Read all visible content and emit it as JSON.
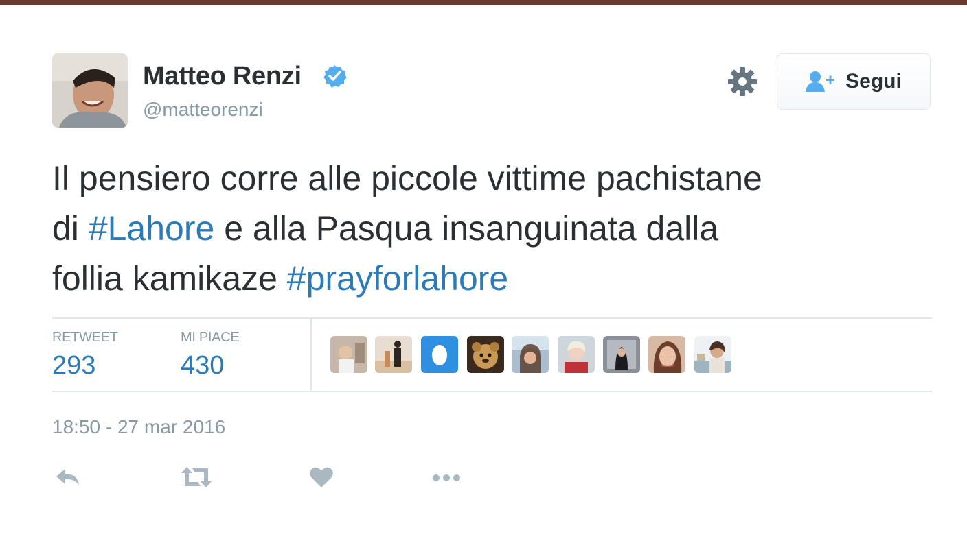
{
  "tweet": {
    "author": {
      "display_name": "Matteo Renzi",
      "handle": "@matteorenzi",
      "verified": true,
      "avatar_icon": "user-avatar-photo"
    },
    "header_actions": {
      "settings_icon": "gear-icon",
      "follow_label": "Segui",
      "follow_icon": "follow-user-icon"
    },
    "text_lines": [
      [
        {
          "text": "Il pensiero corre alle piccole vittime pachistane",
          "type": "text"
        }
      ],
      [
        {
          "text": "di ",
          "type": "text"
        },
        {
          "text": "#Lahore",
          "type": "hashtag"
        },
        {
          "text": " e alla Pasqua insanguinata dalla",
          "type": "text"
        }
      ],
      [
        {
          "text": "follia kamikaze ",
          "type": "text"
        },
        {
          "text": "#prayforlahore",
          "type": "hashtag"
        }
      ]
    ],
    "stats": {
      "retweet_label": "RETWEET",
      "retweet_count": "293",
      "like_label": "MI PIACE",
      "like_count": "430"
    },
    "likers_count_shown": 9,
    "timestamp": "18:50 - 27 mar 2016",
    "actions": [
      "reply-icon",
      "retweet-icon",
      "like-icon",
      "more-icon"
    ]
  },
  "colors": {
    "text": "#292f33",
    "muted": "#8899a6",
    "link": "#2b7bb9",
    "verified": "#55acee",
    "divider": "#e1e8ed",
    "action_icon": "#aab8c2"
  }
}
